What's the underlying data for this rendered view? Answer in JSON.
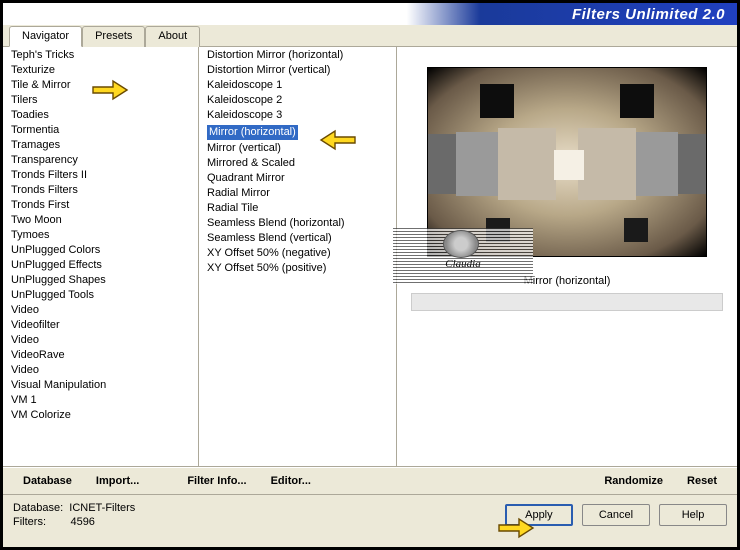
{
  "title": "Filters Unlimited 2.0",
  "tabs": {
    "navigator": "Navigator",
    "presets": "Presets",
    "about": "About"
  },
  "categories": [
    "Teph's Tricks",
    "Texturize",
    "Tile & Mirror",
    "Tilers",
    "Toadies",
    "Tormentia",
    "Tramages",
    "Transparency",
    "Tronds Filters II",
    "Tronds Filters",
    "Tronds First",
    "Two Moon",
    "Tymoes",
    "UnPlugged Colors",
    "UnPlugged Effects",
    "UnPlugged Shapes",
    "UnPlugged Tools",
    "Video",
    "Videofilter",
    "Video",
    "VideoRave",
    "Video",
    "Visual Manipulation",
    "VM 1",
    "VM Colorize"
  ],
  "selected_category_index": 2,
  "filters": [
    "Distortion Mirror (horizontal)",
    "Distortion Mirror (vertical)",
    "Kaleidoscope 1",
    "Kaleidoscope 2",
    "Kaleidoscope 3",
    "Mirror (horizontal)",
    "Mirror (vertical)",
    "Mirrored & Scaled",
    "Quadrant Mirror",
    "Radial Mirror",
    "Radial Tile",
    "Seamless Blend (horizontal)",
    "Seamless Blend (vertical)",
    "XY Offset 50% (negative)",
    "XY Offset 50% (positive)"
  ],
  "selected_filter_index": 5,
  "selected_filter_label": "Mirror (horizontal)",
  "toolbar": {
    "database": "Database",
    "import": "Import...",
    "filter_info": "Filter Info...",
    "editor": "Editor...",
    "randomize": "Randomize",
    "reset": "Reset"
  },
  "status": {
    "db_label": "Database:",
    "db_value": "ICNET-Filters",
    "filters_label": "Filters:",
    "filters_value": "4596"
  },
  "buttons": {
    "apply": "Apply",
    "cancel": "Cancel",
    "help": "Help"
  },
  "watermark": "Claudia"
}
